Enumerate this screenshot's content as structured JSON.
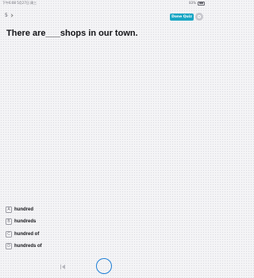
{
  "status_bar": {
    "left": "下午6:08  5月27日 周三",
    "battery": "83%"
  },
  "header": {
    "question_number": "5",
    "done_label": "Done Quiz"
  },
  "question": {
    "text": "There are___shops in our town."
  },
  "options": [
    {
      "letter": "A",
      "text": "hundred"
    },
    {
      "letter": "B",
      "text": "hundreds"
    },
    {
      "letter": "C",
      "text": "hundred of"
    },
    {
      "letter": "D",
      "text": "hundreds of"
    }
  ],
  "icons": {
    "settings": "settings-icon",
    "previous": "previous-icon",
    "home": "home-circle-icon",
    "dropdown": "chevron-down-icon",
    "battery": "battery-icon"
  }
}
